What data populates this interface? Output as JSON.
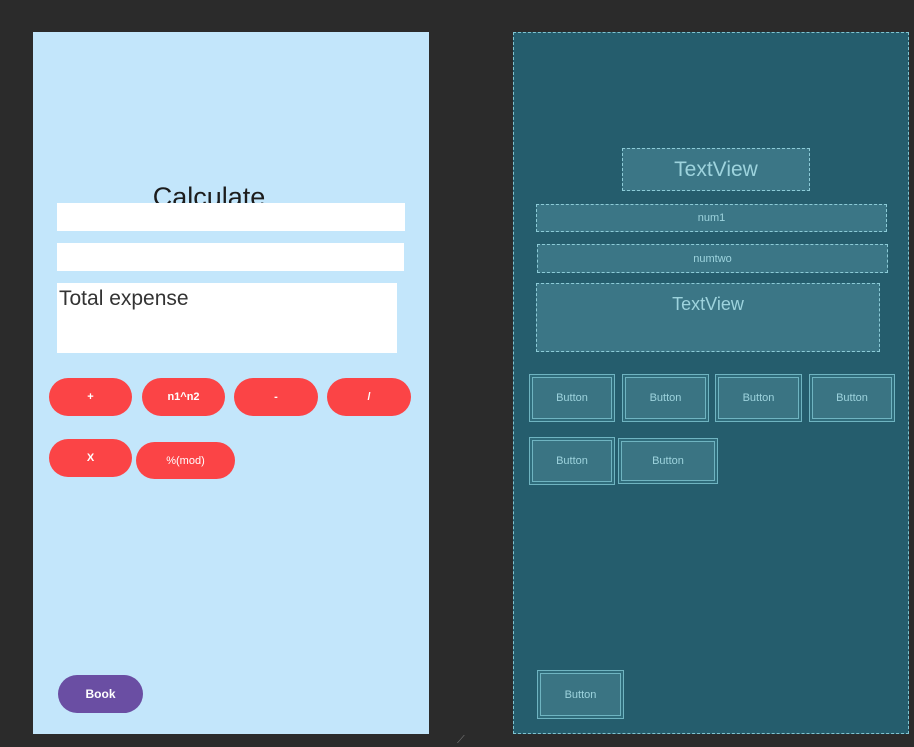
{
  "design": {
    "title": "Calculate",
    "total_label": "Total expense",
    "buttons": {
      "add": "+",
      "power": "n1^n2",
      "subtract": "-",
      "divide": "/",
      "multiply": "X",
      "modulo": "%(mod)"
    },
    "book_label": "Book"
  },
  "blueprint": {
    "title_view": "TextView",
    "num1": "num1",
    "numtwo": "numtwo",
    "result_view": "TextView",
    "button_label": "Button"
  },
  "colors": {
    "design_bg": "#c3e6fb",
    "button_red": "#fb4446",
    "book_purple": "#6a4ea3",
    "blueprint_bg": "#255d6d"
  }
}
